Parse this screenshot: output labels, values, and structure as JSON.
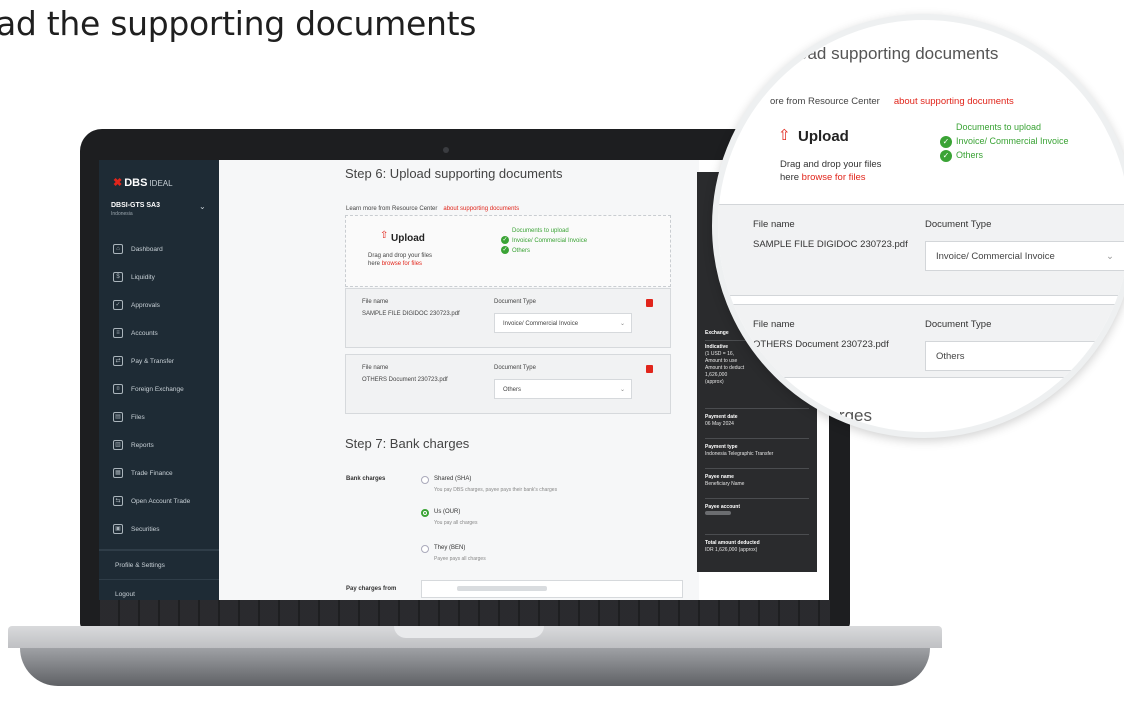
{
  "page_heading": "ad the supporting documents",
  "sidebar": {
    "logo": "DBS",
    "logo_sub": "IDEAL",
    "account_name": "DBSI-GTS SA3",
    "account_country": "Indonesia",
    "items": [
      {
        "label": "Dashboard"
      },
      {
        "label": "Liquidity"
      },
      {
        "label": "Approvals"
      },
      {
        "label": "Accounts"
      },
      {
        "label": "Pay & Transfer"
      },
      {
        "label": "Foreign Exchange"
      },
      {
        "label": "Files"
      },
      {
        "label": "Reports"
      },
      {
        "label": "Trade Finance"
      },
      {
        "label": "Open Account Trade"
      },
      {
        "label": "Securities"
      }
    ],
    "profile": "Profile & Settings",
    "logout": "Logout"
  },
  "step6": {
    "title": "Step 6: Upload supporting documents",
    "learn_more": "Learn more from Resource Center",
    "learn_link": "about supporting documents",
    "upload_title": "Upload",
    "upload_text_1": "Drag and drop your files",
    "upload_text_2": "here",
    "upload_link": "browse for files",
    "docs_header": "Documents to upload",
    "docs": [
      "Invoice/ Commercial Invoice",
      "Others"
    ],
    "files": [
      {
        "file_label": "File name",
        "file_name": "SAMPLE FILE DIGIDOC 230723.pdf",
        "type_label": "Document Type",
        "type_value": "Invoice/ Commercial Invoice"
      },
      {
        "file_label": "File name",
        "file_name": "OTHERS Document 230723.pdf",
        "type_label": "Document Type",
        "type_value": "Others"
      }
    ]
  },
  "step7": {
    "title": "Step 7: Bank charges",
    "label": "Bank charges",
    "options": [
      {
        "title": "Shared (SHA)",
        "desc": "You pay DBS charges, payee pays their bank's charges",
        "selected": false
      },
      {
        "title": "Us (OUR)",
        "desc": "You pay all charges",
        "selected": true
      },
      {
        "title": "They (BEN)",
        "desc": "Payee pays all charges",
        "selected": false
      }
    ],
    "pay_from_label": "Pay charges from"
  },
  "summary": {
    "exchange_label": "Exchange",
    "indicative_label": "Indicative",
    "rate_line": "(1 USD = 16,",
    "amount_use": "Amount to use",
    "amount_deduct": "Amount to deduct",
    "amount_value": "1,626,000",
    "approx": "(approx)",
    "payment_date_label": "Payment date",
    "payment_date": "06 May 2024",
    "payment_type_label": "Payment type",
    "payment_type": "Indonesia Telegraphic Transfer",
    "payee_name_label": "Payee name",
    "payee_name": "Beneficiary Name",
    "payee_account_label": "Payee account",
    "total_label": "Total amount deducted",
    "total_value": "IDR 1,626,000 (approx)"
  },
  "magnifier": {
    "title": "oad supporting documents",
    "learn_more": "ore from Resource Center",
    "learn_link": "about supporting documents",
    "upload_title": "Upload",
    "upload_text_1": "Drag and drop your files",
    "upload_text_2": "here",
    "upload_link": "browse for files",
    "docs_header": "Documents to upload",
    "docs": [
      "Invoice/ Commercial Invoice",
      "Others"
    ],
    "files": [
      {
        "file_label": "File name",
        "file_name": "SAMPLE FILE DIGIDOC 230723.pdf",
        "type_label": "Document Type",
        "type_value": "Invoice/ Commercial Invoice"
      },
      {
        "file_label": "File name",
        "file_name": "OTHERS Document 230723.pdf",
        "type_label": "Document Type",
        "type_value": "Others"
      }
    ],
    "charges": "harges"
  },
  "colors": {
    "brand_red": "#e1251b",
    "success_green": "#3aa335",
    "sidebar_bg": "#1e2b35",
    "summary_bg": "#2a2b2d"
  }
}
